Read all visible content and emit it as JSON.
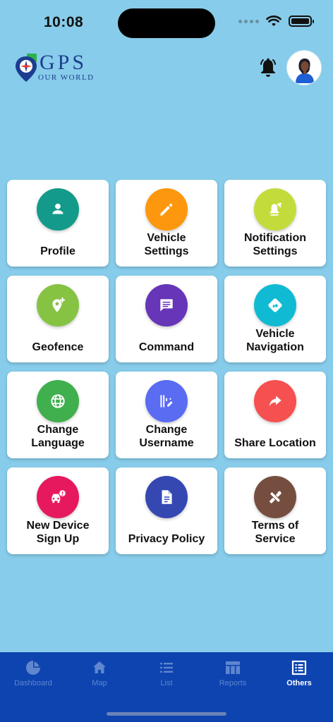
{
  "status_bar": {
    "time": "10:08"
  },
  "header": {
    "logo_title": "GPS",
    "logo_subtitle": "OUR WORLD",
    "brand_colors": {
      "primary": "#1c3d8f",
      "accent": "#2bb34a"
    },
    "bell_icon": "bell-ringing-icon",
    "avatar_icon": "user-avatar"
  },
  "menu": [
    {
      "label": "Profile",
      "icon": "person-icon",
      "color": "#139a8a"
    },
    {
      "label": "Vehicle\nSettings",
      "icon": "pencil-icon",
      "color": "#fd980e"
    },
    {
      "label": "Notification\nSettings",
      "icon": "bell-settings-icon",
      "color": "#c4dc3b"
    },
    {
      "label": "Geofence",
      "icon": "location-add-icon",
      "color": "#86c343"
    },
    {
      "label": "Command",
      "icon": "message-icon",
      "color": "#6735b7"
    },
    {
      "label": "Vehicle\nNavigation",
      "icon": "directions-icon",
      "color": "#11bad3"
    },
    {
      "label": "Change\nLanguage",
      "icon": "globe-icon",
      "color": "#40af4e"
    },
    {
      "label": "Change\nUsername",
      "icon": "edit-text-icon",
      "color": "#5a6cf2"
    },
    {
      "label": "Share Location",
      "icon": "share-arrow-icon",
      "color": "#f75050"
    },
    {
      "label": "New Device\nSign Up",
      "icon": "car-alert-icon",
      "color": "#e7195e"
    },
    {
      "label": "Privacy Policy",
      "icon": "document-icon",
      "color": "#3548b2"
    },
    {
      "label": "Terms of\nService",
      "icon": "tools-icon",
      "color": "#764e40"
    }
  ],
  "bottom_nav": {
    "items": [
      {
        "label": "Dashboard",
        "icon": "pie-chart-icon",
        "active": false
      },
      {
        "label": "Map",
        "icon": "home-icon",
        "active": false
      },
      {
        "label": "List",
        "icon": "list-icon",
        "active": false
      },
      {
        "label": "Reports",
        "icon": "table-icon",
        "active": false
      },
      {
        "label": "Others",
        "icon": "menu-grid-icon",
        "active": true
      }
    ]
  }
}
